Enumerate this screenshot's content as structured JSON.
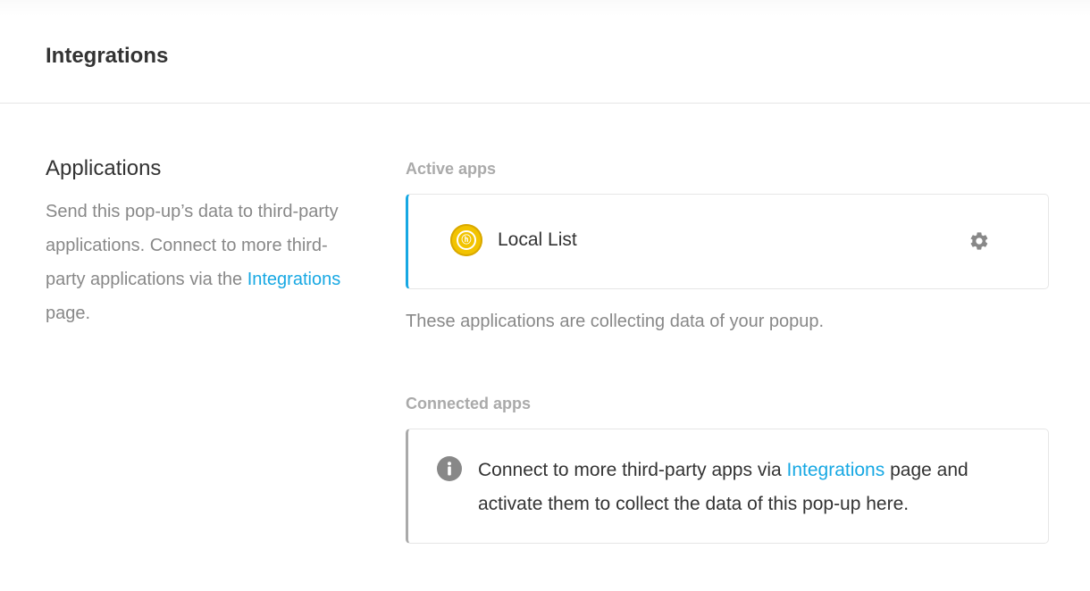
{
  "header": {
    "title": "Integrations"
  },
  "applications": {
    "title": "Applications",
    "description_before_link": "Send this pop-up’s data to third-party applications. Connect to more third-party applications via the ",
    "link_text": "Integrations",
    "description_after_link": " page."
  },
  "active_apps": {
    "label": "Active apps",
    "apps": [
      {
        "name": "Local List",
        "icon": "local-list-logo",
        "settings_icon": "gear-icon"
      }
    ],
    "description": "These applications are collecting data of your popup."
  },
  "connected_apps": {
    "label": "Connected apps",
    "notice_icon": "info-icon",
    "notice_before_link": "Connect to more third-party apps via ",
    "notice_link_text": "Integrations",
    "notice_after_link": " page and activate them to collect the data of this pop-up here."
  },
  "colors": {
    "accent": "#17a8e3",
    "muted_text": "#888888",
    "label_text": "#aaaaaa",
    "logo_yellow": "#f2c300"
  }
}
